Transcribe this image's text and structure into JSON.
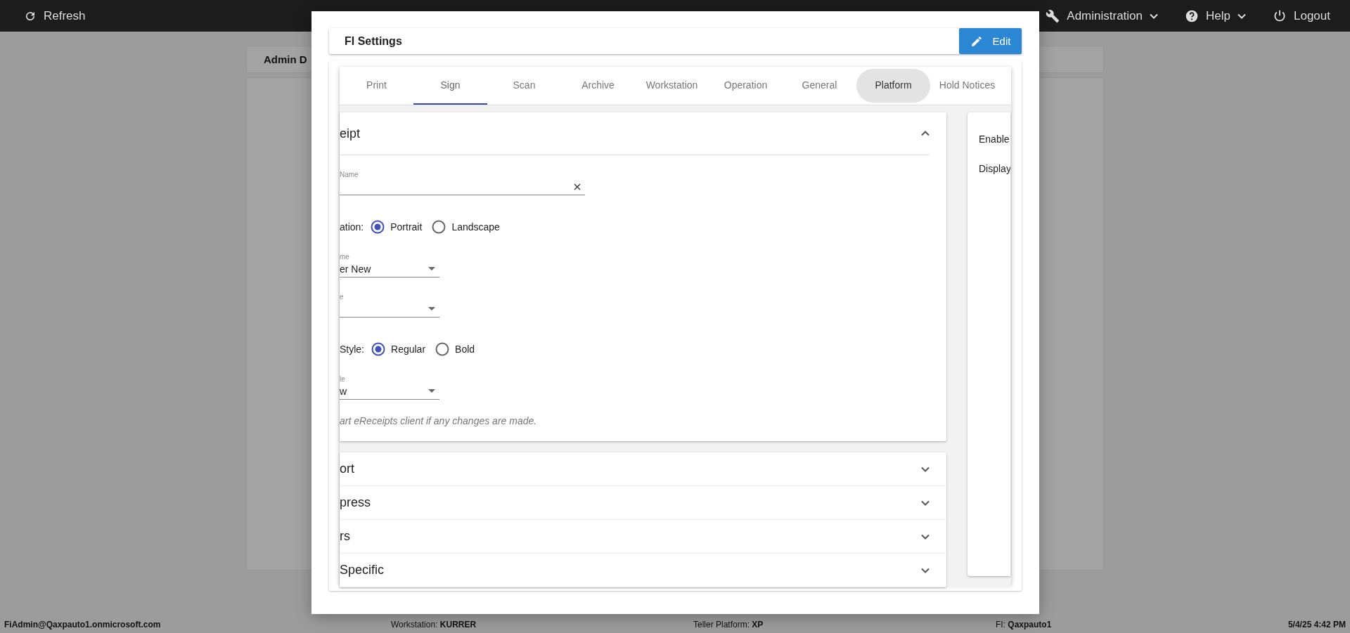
{
  "top_bar": {
    "items": [
      {
        "label": "Refresh",
        "kind": "refresh",
        "dropdown": false
      },
      {
        "label": "Administration",
        "kind": "wrench",
        "dropdown": true
      },
      {
        "label": "Help",
        "kind": "help",
        "dropdown": true
      },
      {
        "label": "Logout",
        "kind": "power",
        "dropdown": false
      }
    ]
  },
  "background_card": {
    "title": "Admin D"
  },
  "modal": {
    "title": "FI Settings",
    "edit_button": "Edit",
    "tabs": [
      {
        "label": "Print",
        "selected": false,
        "hovered": false
      },
      {
        "label": "Sign",
        "selected": true,
        "hovered": false
      },
      {
        "label": "Scan",
        "selected": false,
        "hovered": false
      },
      {
        "label": "Archive",
        "selected": false,
        "hovered": false
      },
      {
        "label": "Workstation",
        "selected": false,
        "hovered": false
      },
      {
        "label": "Operation",
        "selected": false,
        "hovered": false
      },
      {
        "label": "General",
        "selected": false,
        "hovered": false
      },
      {
        "label": "Platform",
        "selected": false,
        "hovered": true
      },
      {
        "label": "Hold Notices",
        "selected": false,
        "hovered": false
      }
    ],
    "open_section": {
      "title": "eipt",
      "expanded": true,
      "fields": [
        {
          "kind": "text",
          "label": "Name",
          "clearable": true
        },
        {
          "kind": "radio",
          "label": "ation:",
          "options": [
            {
              "label": "Portrait",
              "selected": true
            },
            {
              "label": "Landscape",
              "selected": false
            }
          ]
        },
        {
          "kind": "select",
          "label": "me",
          "value": "er New"
        },
        {
          "kind": "select",
          "label": "e"
        },
        {
          "kind": "radio",
          "label": "Style:",
          "options": [
            {
              "label": "Regular",
              "selected": true
            },
            {
              "label": "Bold",
              "selected": false
            }
          ]
        },
        {
          "kind": "select",
          "label": "le",
          "value": "w"
        },
        {
          "kind": "note",
          "text": "art eReceipts client if any changes are made."
        }
      ]
    },
    "collapsed_sections": [
      {
        "title": "ort",
        "expanded": false
      },
      {
        "title": "press",
        "expanded": false
      },
      {
        "title": "rs",
        "expanded": false
      },
      {
        "title": "Specific",
        "expanded": false
      }
    ],
    "side_panel": {
      "items": [
        "Enable",
        "Display"
      ]
    }
  },
  "status_bar": [
    {
      "label": "FiAdmin@Qaxpauto1.onmicrosoft.com",
      "kind": "user"
    },
    {
      "label": "Workstation: ",
      "value": "KURRER",
      "kind": "pair"
    },
    {
      "label": "Teller Platform: ",
      "value": "XP",
      "kind": "pair"
    },
    {
      "label": "FI: ",
      "value": "Qaxpauto1",
      "kind": "pair"
    },
    {
      "label": "5/4/25 4:42 PM",
      "kind": "time"
    }
  ]
}
